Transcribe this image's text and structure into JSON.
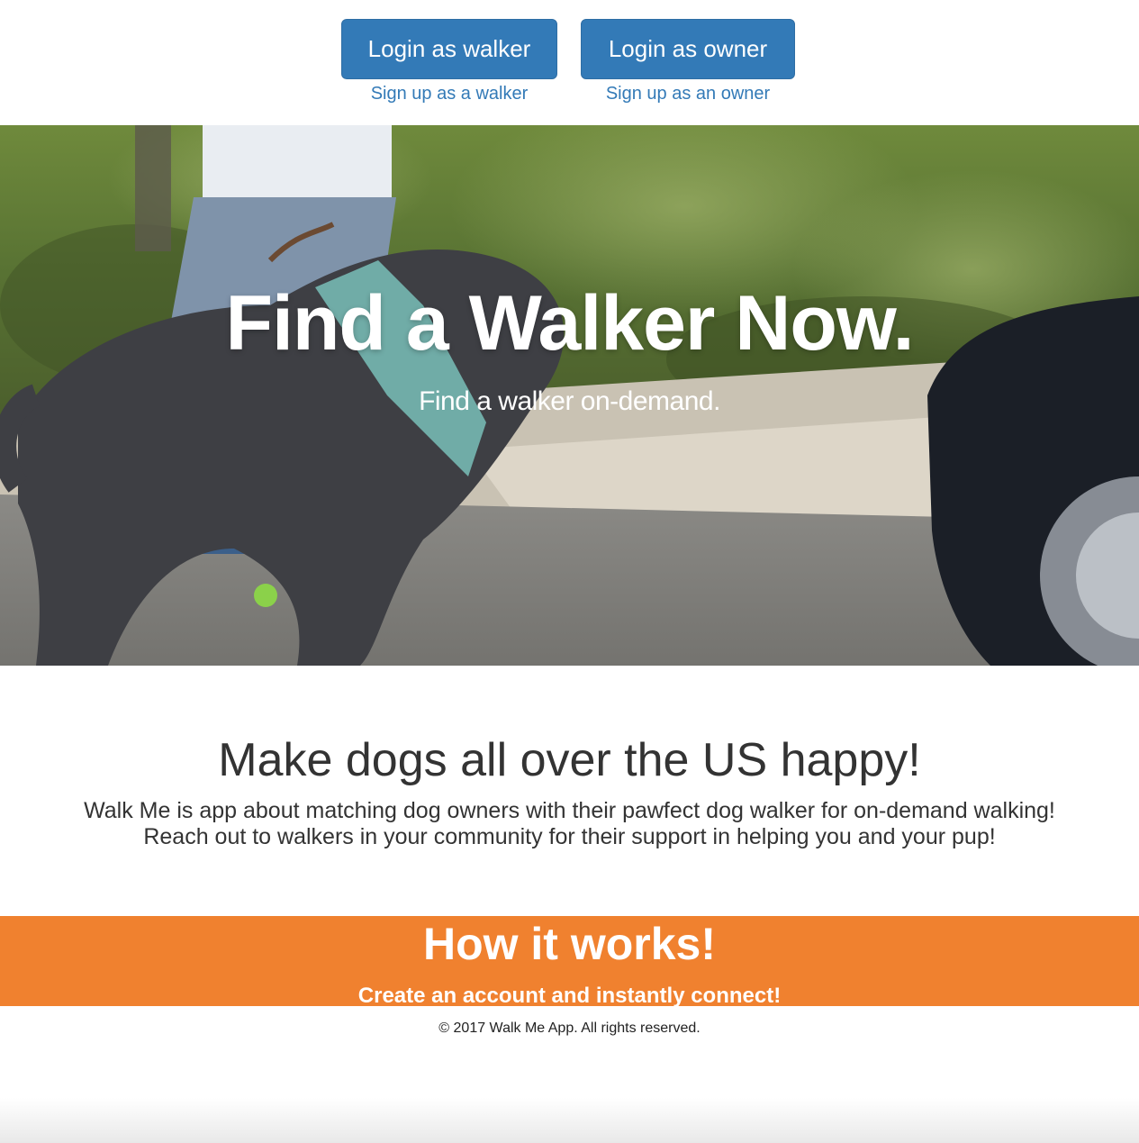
{
  "auth": {
    "walker": {
      "login_label": "Login as walker",
      "signup_label": "Sign up as a walker"
    },
    "owner": {
      "login_label": "Login as owner",
      "signup_label": "Sign up as an owner"
    }
  },
  "hero": {
    "title": "Find a Walker Now.",
    "subtitle": "Find a walker on-demand."
  },
  "about": {
    "heading": "Make dogs all over the US happy!",
    "body": "Walk Me is app about matching dog owners with their pawfect dog walker for on-demand walking! Reach out to walkers in your community for their support in helping you and your pup!"
  },
  "how_it_works": {
    "heading": "How it works!",
    "tagline": "Create an account and instantly connect!"
  },
  "footer": {
    "copyright": "© 2017 Walk Me App. All rights reserved."
  },
  "colors": {
    "primary": "#337ab7",
    "accent_orange": "#f0812f",
    "text": "#333333"
  }
}
